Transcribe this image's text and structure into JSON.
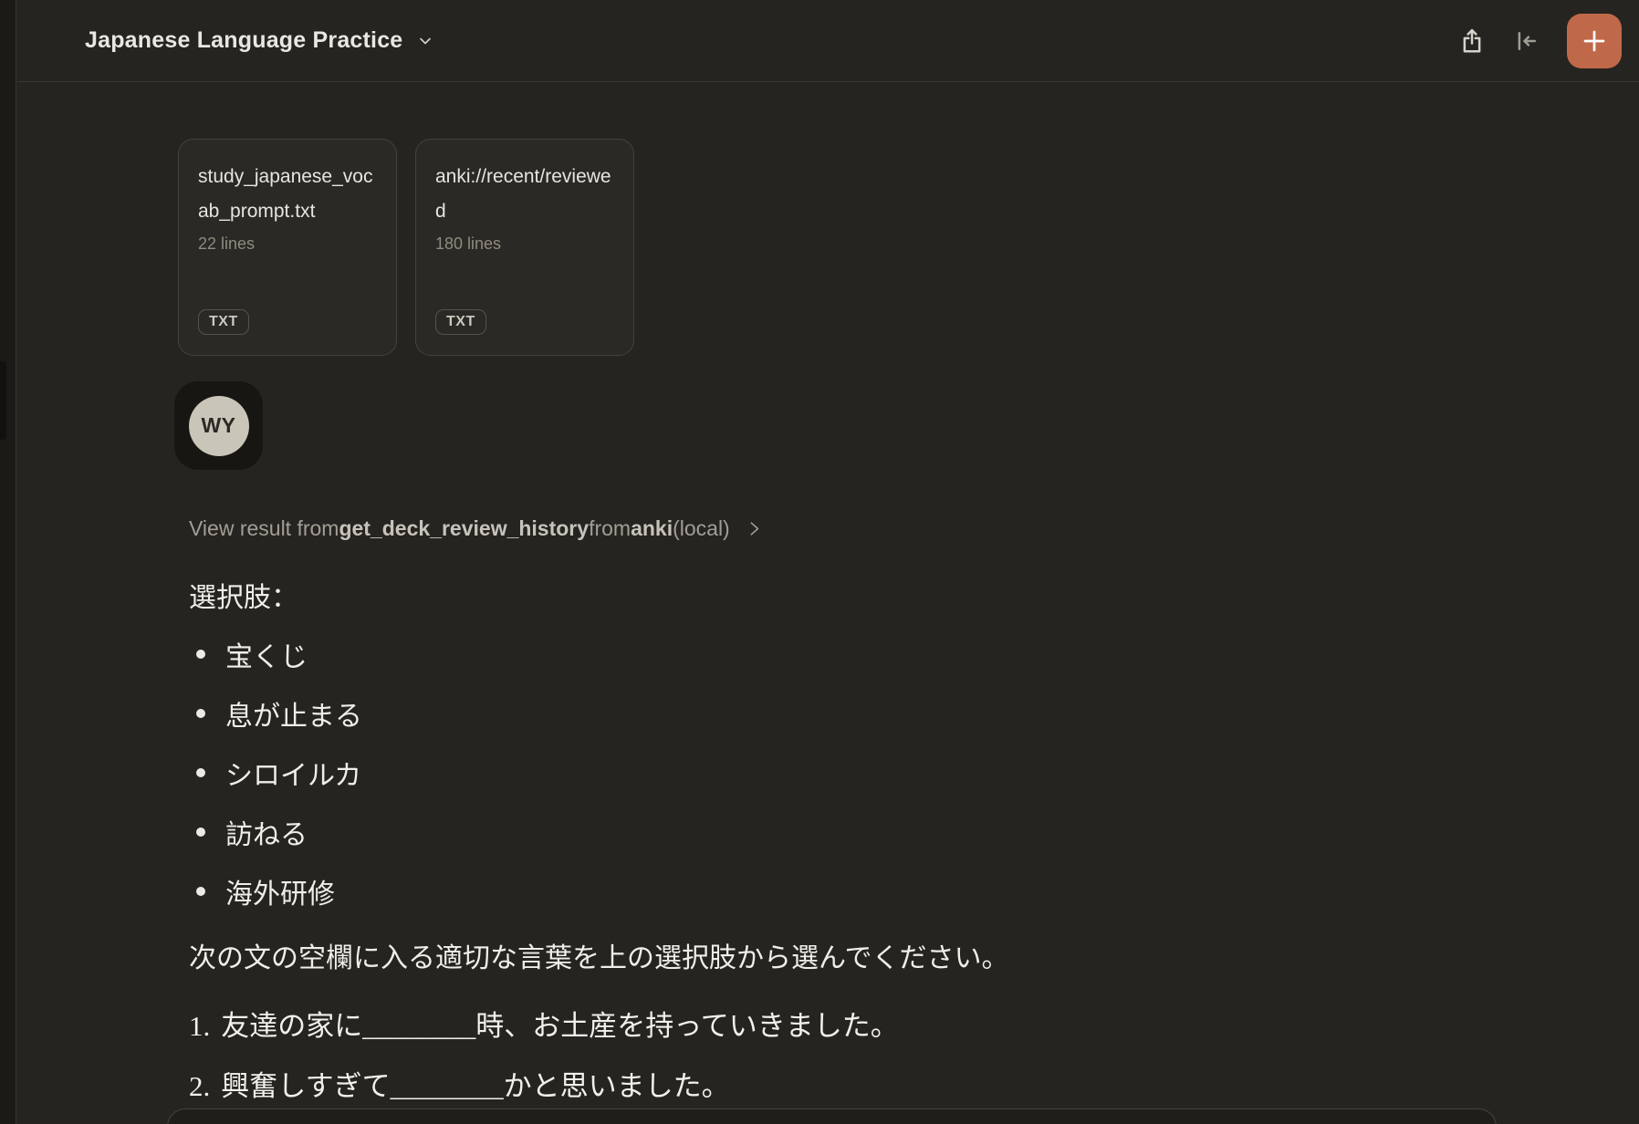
{
  "header": {
    "title": "Japanese Language Practice"
  },
  "attachments": [
    {
      "filename": "study_japanese_vocab_prompt.txt",
      "meta": "22 lines",
      "badge": "TXT"
    },
    {
      "filename": "anki://recent/reviewed",
      "meta": "180 lines",
      "badge": "TXT"
    }
  ],
  "user": {
    "avatar_initials": "WY"
  },
  "tool_result": {
    "prefix": "View result from ",
    "tool_name": "get_deck_review_history",
    "middle": " from ",
    "server_name": "anki",
    "suffix": " (local)"
  },
  "message": {
    "heading": "選択肢：",
    "options": [
      "宝くじ",
      "息が止まる",
      "シロイルカ",
      "訪ねる",
      "海外研修"
    ],
    "instruction": "次の文の空欄に入る適切な言葉を上の選択肢から選んでください。",
    "questions": [
      {
        "number": "1.",
        "text": "友達の家に________時、お土産を持っていきました。"
      },
      {
        "number": "2.",
        "text": "興奮しすぎて________かと思いました。"
      }
    ]
  },
  "colors": {
    "accent": "#c0694a",
    "background": "#262421",
    "rail": "#1c1a17"
  },
  "icons": {
    "chevron_down": "chevron-down",
    "share": "share-up-arrow-box",
    "collapse": "collapse-to-left",
    "plus": "plus",
    "chevron_right": "chevron-right"
  }
}
